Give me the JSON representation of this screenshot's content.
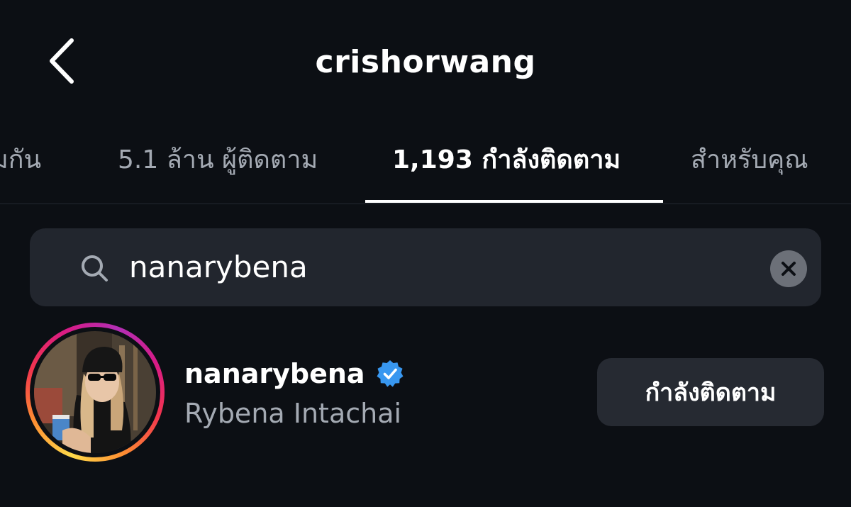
{
  "header": {
    "title": "crishorwang",
    "back_icon": "chevron-left-icon"
  },
  "tabs": [
    {
      "label": "มกัน",
      "active": false
    },
    {
      "label": "5.1 ล้าน ผู้ติดตาม",
      "active": false
    },
    {
      "label": "1,193 กำลังติดตาม",
      "active": true
    },
    {
      "label": "สำหรับคุณ",
      "active": false
    }
  ],
  "search": {
    "value": "nanarybena",
    "icon": "search-icon",
    "clear_icon": "close-icon"
  },
  "results": [
    {
      "username": "nanarybena",
      "verified": true,
      "full_name": "Rybena Intachai",
      "button_label": "กำลังติดตาม"
    }
  ],
  "colors": {
    "background": "#0c0f14",
    "search_bg": "#22262e",
    "button_bg": "#262a32",
    "muted_text": "#a4aab3",
    "verified_blue": "#3897f0"
  }
}
